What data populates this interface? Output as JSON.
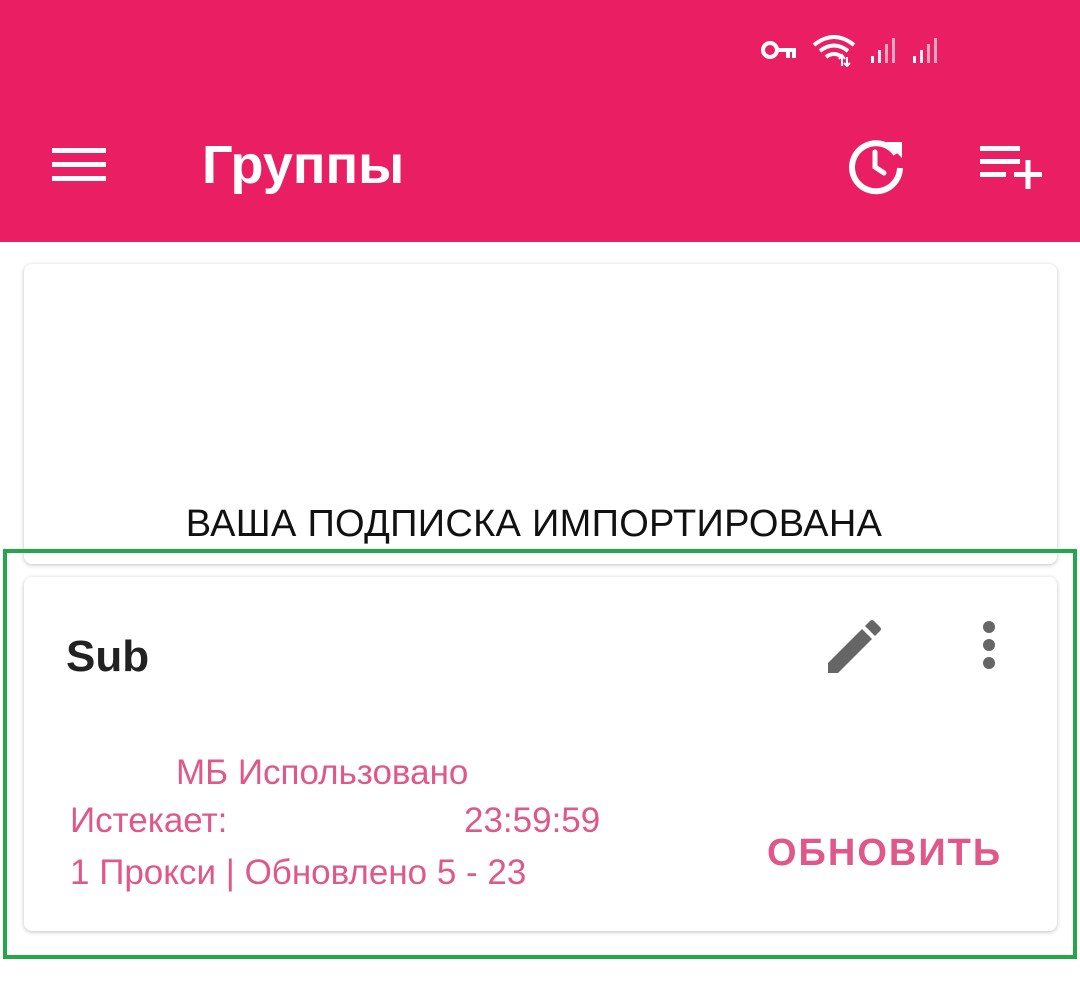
{
  "colors": {
    "appbar": "#E91E63",
    "accent_text": "#E0578A",
    "highlight_border": "#22A84A"
  },
  "status_bar": {
    "icons": [
      "vpn-key-icon",
      "wifi-icon",
      "signal-icon-1",
      "signal-icon-2"
    ]
  },
  "appbar": {
    "title": "Группы",
    "icons": [
      "menu-icon",
      "refresh-clock-icon",
      "playlist-add-icon"
    ]
  },
  "annotation": {
    "caption": "ВАША ПОДПИСКА ИМПОРТИРОВАНА"
  },
  "group_card": {
    "name": "Sub",
    "used": "МБ Использовано",
    "expires_label": "Истекает:",
    "expires_time": "23:59:59",
    "proxy_info": "1 Прокси | Обновлено 5 - 23",
    "update_label": "ОБНОВИТЬ",
    "icons": [
      "edit-icon",
      "more-vert-icon"
    ]
  }
}
